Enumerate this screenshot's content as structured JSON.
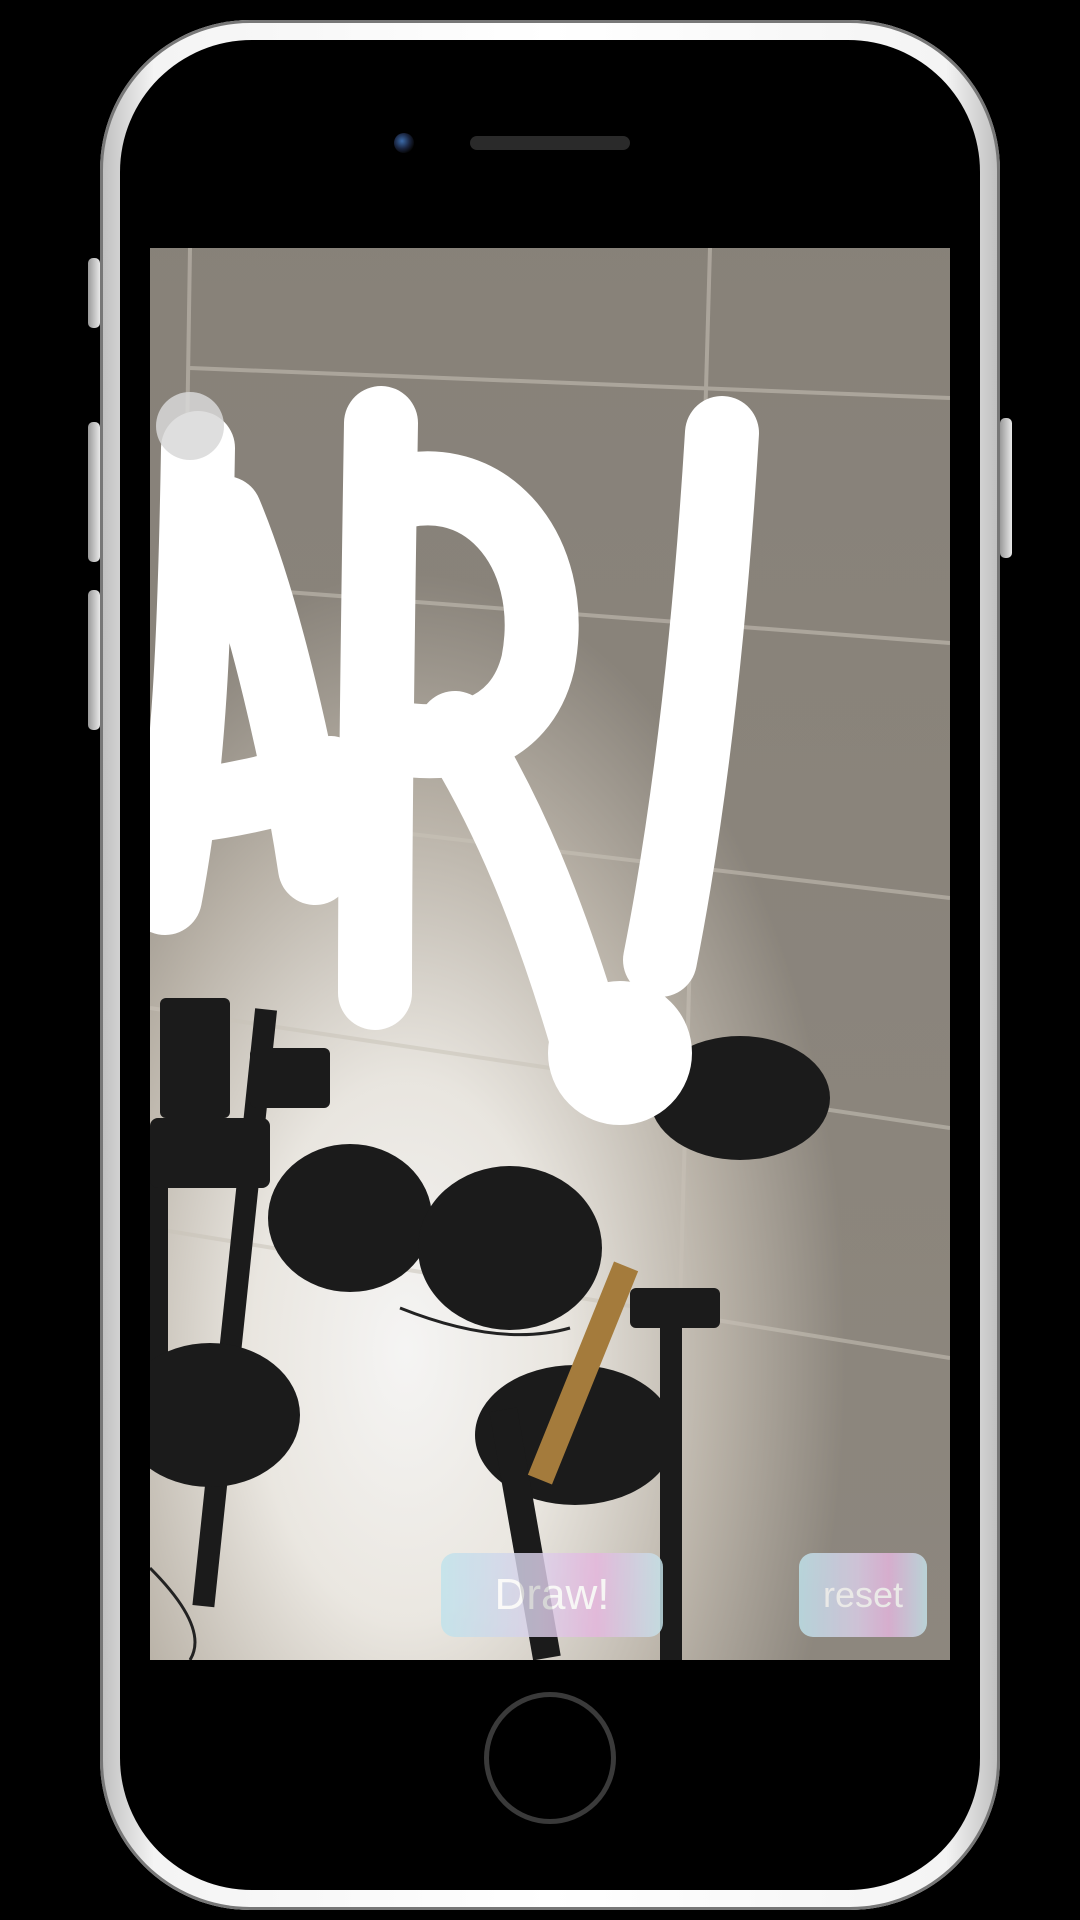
{
  "app": {
    "buttons": {
      "draw_label": "Draw!",
      "reset_label": "reset"
    },
    "drawing": {
      "stroke_color": "#ffffff",
      "written_text": "AR!"
    },
    "button_gradient": [
      "#bfe3ec",
      "#dcd0ea",
      "#e6b6df",
      "#c4e3ea"
    ]
  },
  "device": {
    "model": "phone-mockup",
    "frame_color": "#f2f2f2",
    "bezel_color": "#000000"
  },
  "icons": {
    "home": "home-button-icon",
    "camera": "front-camera-icon",
    "earpiece": "earpiece-speaker-icon"
  }
}
